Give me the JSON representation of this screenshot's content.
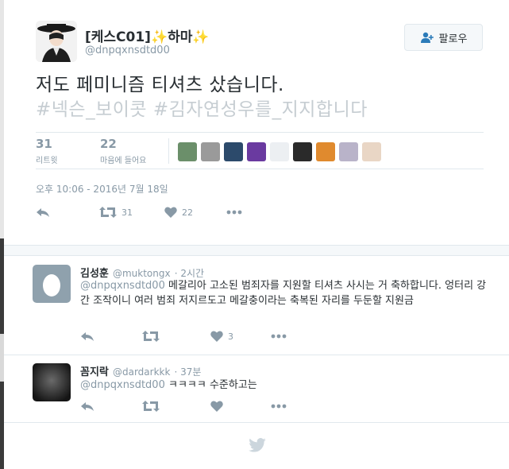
{
  "tweet": {
    "display_name": "[케스C01]",
    "display_name_suffix": "하마",
    "handle": "@dnpqxnsdtd00",
    "follow_label": "팔로우",
    "text_line1": "저도 페미니즘 티셔츠 샀습니다.",
    "text_hashtags": "#넥슨_보이콧 #김자연성우를_지지합니다",
    "retweets_count": "31",
    "retweets_label": "리트윗",
    "likes_count": "22",
    "likes_label": "마음에 들어요",
    "timestamp": "오후 10:06 - 2016년 7월 18일",
    "action_retweet_count": "31",
    "action_like_count": "22"
  },
  "likers": [
    {
      "name": "liker-1",
      "color": "#6b8f6a"
    },
    {
      "name": "liker-2",
      "color": "#9a9a9a"
    },
    {
      "name": "liker-3",
      "color": "#2c4a6b"
    },
    {
      "name": "liker-4",
      "color": "#6a3aa0"
    },
    {
      "name": "liker-5",
      "color": "#eceff2"
    },
    {
      "name": "liker-6",
      "color": "#2a2a2a"
    },
    {
      "name": "liker-7",
      "color": "#e08a2e"
    },
    {
      "name": "liker-8",
      "color": "#b9b3c9"
    },
    {
      "name": "liker-9",
      "color": "#e9d6c5"
    }
  ],
  "replies": [
    {
      "name": "김성훈",
      "handle": "@muktongx",
      "time": "· 2시간",
      "mention": "@dnpqxnsdtd00",
      "text_first": "메갈리아 고소된 범죄자를 지원할 티셔츠 사시는 거 축하합니다.",
      "text_rest": "엉터리 강간 조작이니 여러 범죄 저지르도고 메갈충이라는 축복된 자리를 두둔할 지원금",
      "like_count": "3"
    },
    {
      "name": "꼼지락",
      "handle": "@dardarkkk",
      "time": "· 37분",
      "mention": "@dnpqxnsdtd00",
      "text_first": "ㅋㅋㅋㅋ 수준하고는",
      "text_rest": "",
      "like_count": ""
    }
  ],
  "colors": {
    "text": "#292f33",
    "muted": "#8899a6",
    "hashtag": "#c6cdd2",
    "border": "#e1e8ed",
    "bird": "#ccd6dd"
  }
}
